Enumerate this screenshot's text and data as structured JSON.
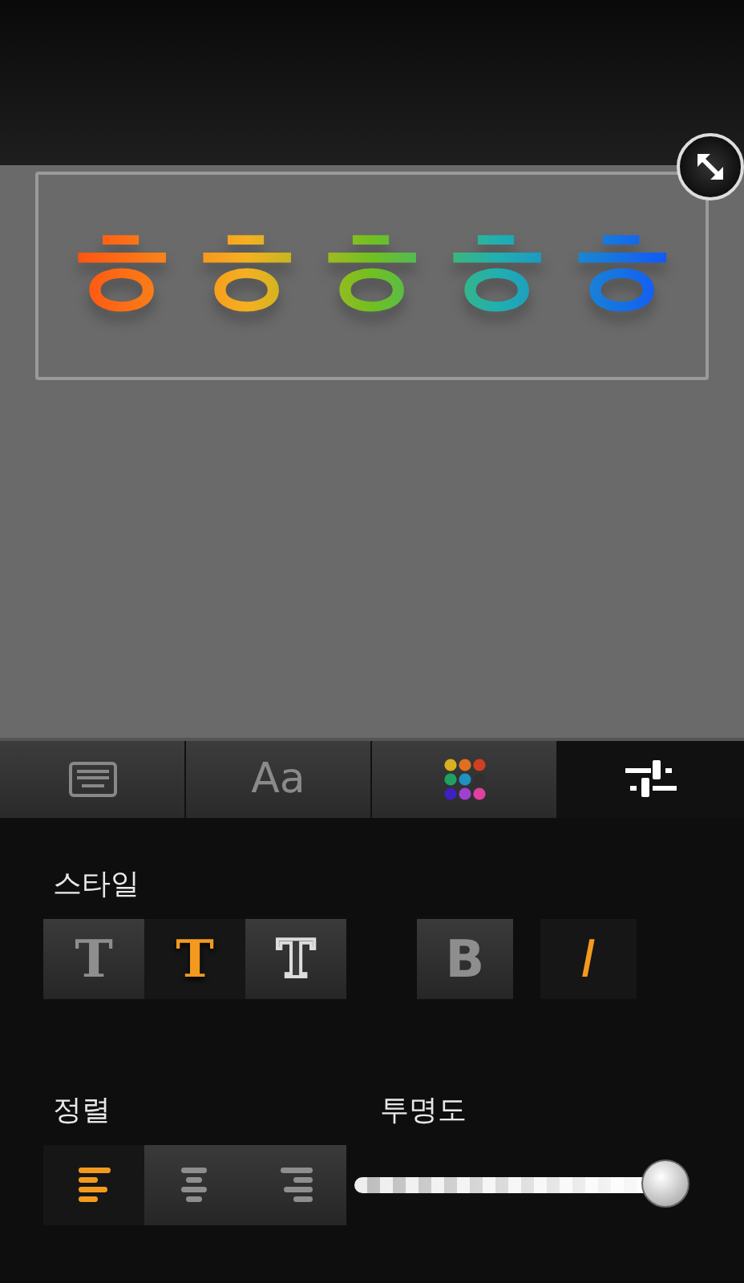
{
  "preview": {
    "text": "ㅎㅎㅎㅎㅎ"
  },
  "tabs": [
    {
      "kind": "keyboard",
      "selected": false
    },
    {
      "kind": "text",
      "label": "Aa",
      "selected": false
    },
    {
      "kind": "palette",
      "selected": false
    },
    {
      "kind": "sliders",
      "selected": true
    }
  ],
  "style_section": {
    "title": "스타일",
    "effects": [
      {
        "kind": "plain",
        "glyph": "T",
        "selected": false
      },
      {
        "kind": "shadow",
        "glyph": "T",
        "selected": true
      },
      {
        "kind": "outline",
        "glyph": "T",
        "selected": false
      }
    ],
    "bold": {
      "glyph": "B",
      "selected": false
    },
    "italic": {
      "glyph": "I",
      "selected": true
    }
  },
  "align_section": {
    "title": "정렬",
    "options": [
      {
        "kind": "left",
        "selected": true
      },
      {
        "kind": "center",
        "selected": false
      },
      {
        "kind": "right",
        "selected": false
      }
    ]
  },
  "opacity_section": {
    "title": "투명도",
    "level": 0.97
  }
}
